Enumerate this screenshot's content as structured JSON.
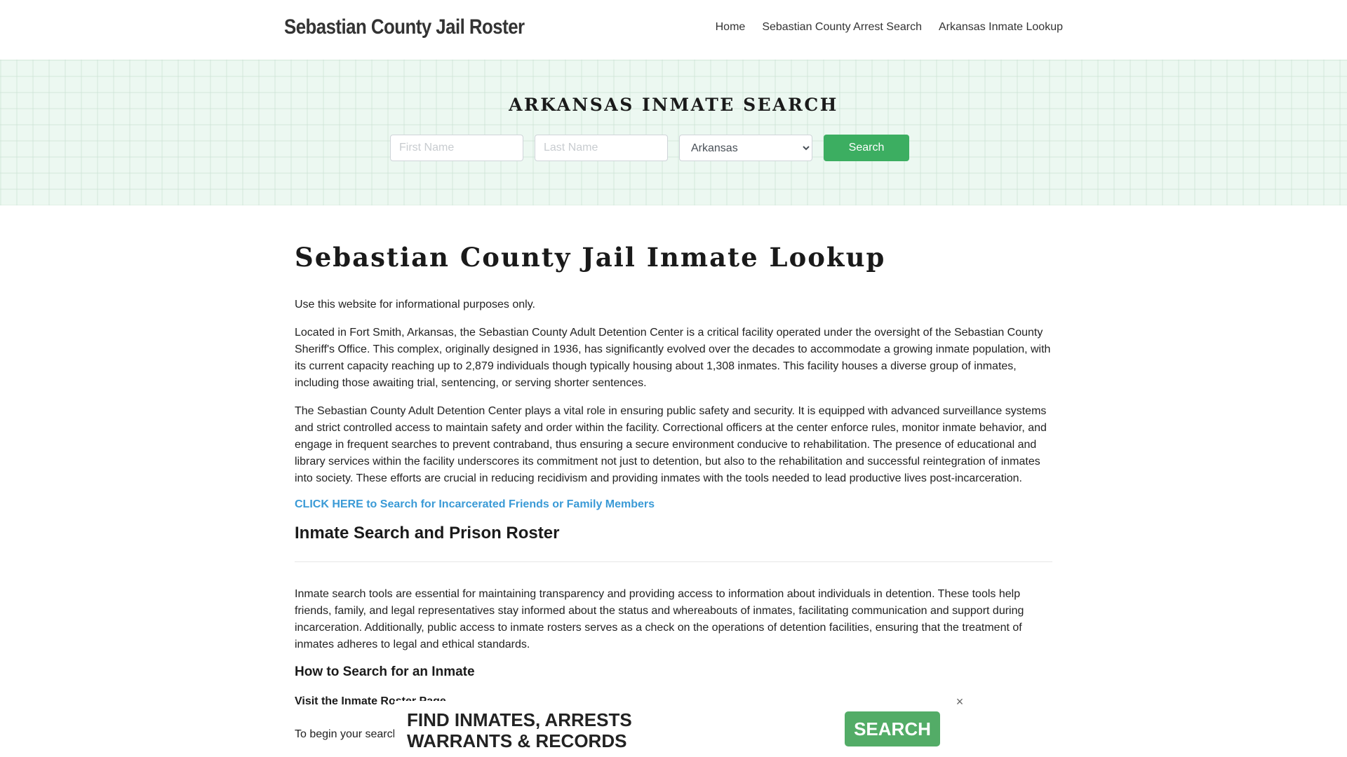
{
  "header": {
    "logo": "Sebastian County Jail Roster",
    "nav": [
      {
        "label": "Home"
      },
      {
        "label": "Sebastian County Arrest Search"
      },
      {
        "label": "Arkansas Inmate Lookup"
      }
    ]
  },
  "hero": {
    "title": "ARKANSAS INMATE SEARCH",
    "first_name_placeholder": "First Name",
    "last_name_placeholder": "Last Name",
    "state_selected": "Arkansas",
    "search_label": "Search"
  },
  "main": {
    "title": "Sebastian County Jail Inmate Lookup",
    "intro": "Use this website for informational purposes only.",
    "para1": "Located in Fort Smith, Arkansas, the Sebastian County Adult Detention Center is a critical facility operated under the oversight of the Sebastian County Sheriff's Office. This complex, originally designed in 1936, has significantly evolved over the decades to accommodate a growing inmate population, with its current capacity reaching up to 2,879 individuals though typically housing about 1,308 inmates. This facility houses a diverse group of inmates, including those awaiting trial, sentencing, or serving shorter sentences.",
    "para2": "The Sebastian County Adult Detention Center plays a vital role in ensuring public safety and security. It is equipped with advanced surveillance systems and strict controlled access to maintain safety and order within the facility. Correctional officers at the center enforce rules, monitor inmate behavior, and engage in frequent searches to prevent contraband, thus ensuring a secure environment conducive to rehabilitation. The presence of educational and library services within the facility underscores its commitment not just to detention, but also to the rehabilitation and successful reintegration of inmates into society. These efforts are crucial in reducing recidivism and providing inmates with the tools needed to lead productive lives post-incarceration.",
    "cta_link": "CLICK HERE to Search for Incarcerated Friends or Family Members",
    "section_title": "Inmate Search and Prison Roster",
    "para3": "Inmate search tools are essential for maintaining transparency and providing access to information about individuals in detention. These tools help friends, family, and legal representatives stay informed about the status and whereabouts of inmates, facilitating communication and support during incarceration. Additionally, public access to inmate rosters serves as a check on the operations of detention facilities, ensuring that the treatment of inmates adheres to legal and ethical standards.",
    "subsection_title": "How to Search for an Inmate",
    "step_title": "Visit the Inmate Roster Page",
    "para4": "To begin your search ... tool is designed to provide up-to-date i..."
  },
  "ad": {
    "line1": "FIND INMATES, ARRESTS",
    "line2": "WARRANTS & RECORDS",
    "button_label": "SEARCH",
    "close_glyph": "×"
  }
}
